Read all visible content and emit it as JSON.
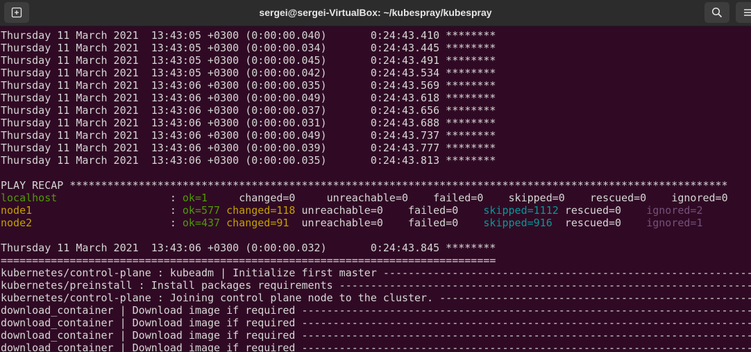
{
  "window": {
    "title": "sergei@sergei-VirtualBox: ~/kubespray/kubespray",
    "icons": {
      "new_tab": "new-tab-icon",
      "search": "search-icon",
      "menu": "hamburger-menu-icon"
    }
  },
  "terminal": {
    "timing_lines": [
      "Thursday 11 March 2021  13:43:05 +0300 (0:00:00.040)       0:24:43.410 ********",
      "Thursday 11 March 2021  13:43:05 +0300 (0:00:00.034)       0:24:43.445 ********",
      "Thursday 11 March 2021  13:43:05 +0300 (0:00:00.045)       0:24:43.491 ********",
      "Thursday 11 March 2021  13:43:05 +0300 (0:00:00.042)       0:24:43.534 ********",
      "Thursday 11 March 2021  13:43:06 +0300 (0:00:00.035)       0:24:43.569 ********",
      "Thursday 11 March 2021  13:43:06 +0300 (0:00:00.049)       0:24:43.618 ********",
      "Thursday 11 March 2021  13:43:06 +0300 (0:00:00.037)       0:24:43.656 ********",
      "Thursday 11 March 2021  13:43:06 +0300 (0:00:00.031)       0:24:43.688 ********",
      "Thursday 11 March 2021  13:43:06 +0300 (0:00:00.049)       0:24:43.737 ********",
      "Thursday 11 March 2021  13:43:06 +0300 (0:00:00.039)       0:24:43.777 ********",
      "Thursday 11 March 2021  13:43:06 +0300 (0:00:00.035)       0:24:43.813 ********"
    ],
    "recap_header": "PLAY RECAP *********************************************************************************************************",
    "recap": {
      "localhost": {
        "host": "localhost                  ",
        "colon": ": ",
        "ok": "ok=1     ",
        "changed": "changed=0     ",
        "unreachable": "unreachable=0    ",
        "failed": "failed=0    ",
        "skipped": "skipped=0    ",
        "rescued": "rescued=0    ",
        "ignored": "ignored=0"
      },
      "node1": {
        "host": "node1                      ",
        "colon": ": ",
        "ok": "ok=577 ",
        "changed": "changed=118 ",
        "unreachable": "unreachable=0    ",
        "failed": "failed=0    ",
        "skipped": "skipped=1112 ",
        "rescued": "rescued=0    ",
        "ignored": "ignored=2"
      },
      "node2": {
        "host": "node2                      ",
        "colon": ": ",
        "ok": "ok=437 ",
        "changed": "changed=91  ",
        "unreachable": "unreachable=0    ",
        "failed": "failed=0    ",
        "skipped": "skipped=916  ",
        "rescued": "rescued=0    ",
        "ignored": "ignored=1"
      }
    },
    "final_timing": "Thursday 11 March 2021  13:43:06 +0300 (0:00:00.032)       0:24:43.845 ********",
    "separator": "===============================================================================",
    "task_lines": [
      "kubernetes/control-plane : kubeadm | Initialize first master ------------------------------------------------------------",
      "kubernetes/preinstall : Install packages requirements ---------------------------------------------------------------------",
      "kubernetes/control-plane : Joining control plane node to the cluster. -----------------------------------------------------",
      "download_container | Download image if required ----------------------------------------------------------------------------",
      "download_container | Download image if required ----------------------------------------------------------------------------",
      "download_container | Download image if required ----------------------------------------------------------------------------",
      "download_container | Download image if required ----------------------------------------------------------------------------"
    ],
    "colors": {
      "background": "#300a24",
      "text": "#d6d6d6",
      "ok_green": "#4e9a06",
      "changed_yellow": "#c4a000",
      "skipped_cyan": "#06989a",
      "ignored_magenta": "#75507b"
    }
  }
}
